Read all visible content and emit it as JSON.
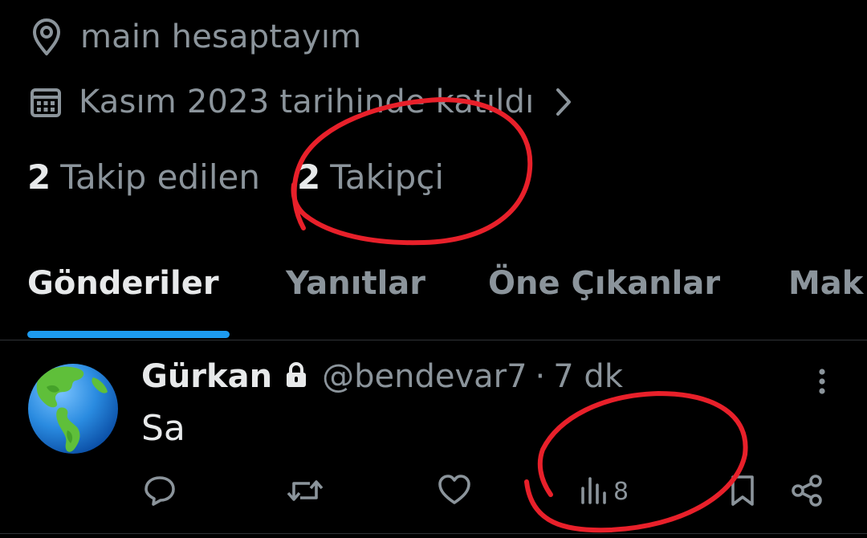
{
  "profile": {
    "location": "main hesaptayım",
    "joined": "Kasım 2023 tarihinde katıldı",
    "following_count": "2",
    "following_label": "Takip edilen",
    "followers_count": "2",
    "followers_label": "Takipçi"
  },
  "tabs": [
    {
      "label": "Gönderiler",
      "active": true
    },
    {
      "label": "Yanıtlar",
      "active": false
    },
    {
      "label": "Öne Çıkanlar",
      "active": false
    },
    {
      "label": "Mak",
      "active": false
    }
  ],
  "post": {
    "author": "Gürkan",
    "handle": "@bendevar7",
    "separator": "·",
    "time": "7 dk",
    "text": "Sa",
    "views": "8"
  },
  "icons": {
    "location": "map-pin-icon",
    "calendar": "calendar-icon",
    "chevron": "chevron-right-icon",
    "lock": "lock-icon",
    "more": "more-vertical-icon",
    "reply": "reply-icon",
    "repost": "repost-icon",
    "like": "heart-icon",
    "views": "views-icon",
    "bookmark": "bookmark-icon",
    "share": "share-icon"
  },
  "colors": {
    "background": "#000000",
    "text": "#e7e9ea",
    "muted": "#8b949b",
    "accent": "#1d9bf0",
    "annotation": "#e8202a"
  }
}
